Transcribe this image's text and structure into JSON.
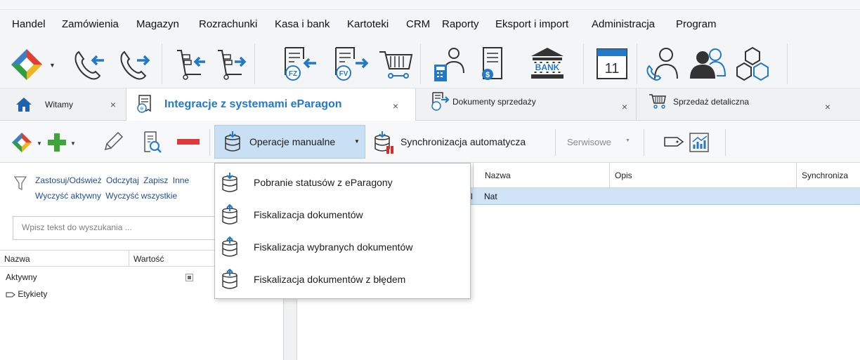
{
  "menubar": {
    "items": [
      "Handel",
      "Zamówienia",
      "Magazyn",
      "Rozrachunki",
      "Kasa i bank",
      "Kartoteki",
      "CRM",
      "Raporty",
      "Eksport i import",
      "Administracja",
      "Program"
    ]
  },
  "ribbon": {
    "icons": [
      "app-logo-icon",
      "incoming-call-icon",
      "outgoing-call-icon",
      "goods-receipt-icon",
      "goods-issue-icon",
      "purchase-invoice-icon",
      "sales-invoice-icon",
      "cash-register-cart-icon",
      "calculator-person-icon",
      "payment-document-icon",
      "bank-icon",
      "calendar-icon",
      "contact-person-icon",
      "users-icon",
      "products-icon"
    ],
    "bank_label": "BANK",
    "calendar_day": "11",
    "fz_label": "FZ",
    "fv_label": "FV"
  },
  "tabs": [
    {
      "label": "Witamy",
      "close": "×"
    },
    {
      "label": "Integracje z systemami eParagon",
      "close": "×"
    },
    {
      "label": "Dokumenty sprzedaży",
      "close": "×"
    },
    {
      "label": "Sprzedaż detaliczna",
      "close": "×"
    }
  ],
  "toolbar": {
    "manual_label": "Operacje manualne",
    "auto_label": "Synchronizacja automatycza",
    "service_label": "Serwisowe"
  },
  "filter": {
    "line1": [
      "Zastosuj/Odśwież",
      "Odczytaj",
      "Zapisz",
      "Inne"
    ],
    "line2": [
      "Wyczyść aktywny",
      "Wyczyść wszystkie"
    ],
    "search_placeholder": "Wpisz tekst do wyszukania ..."
  },
  "props": {
    "columns": [
      "Nazwa",
      "Wartość"
    ],
    "rows": [
      {
        "name": "Aktywny",
        "checked": true
      },
      {
        "name": "Etykiety"
      }
    ]
  },
  "grid": {
    "columns": [
      "Nazwa",
      "Opis",
      "Synchroniza"
    ],
    "row": {
      "prefix": "l",
      "name": "Nat"
    }
  },
  "dropdown": {
    "items": [
      "Pobranie statusów z eParagony",
      "Fiskalizacja dokumentów",
      "Fiskalizacja wybranych dokumentów",
      "Fiskalizacja dokumentów z błędem"
    ]
  },
  "colors": {
    "accent": "#2479c6",
    "selected_row": "#d0e3f7",
    "active_button": "#c9dff3"
  }
}
